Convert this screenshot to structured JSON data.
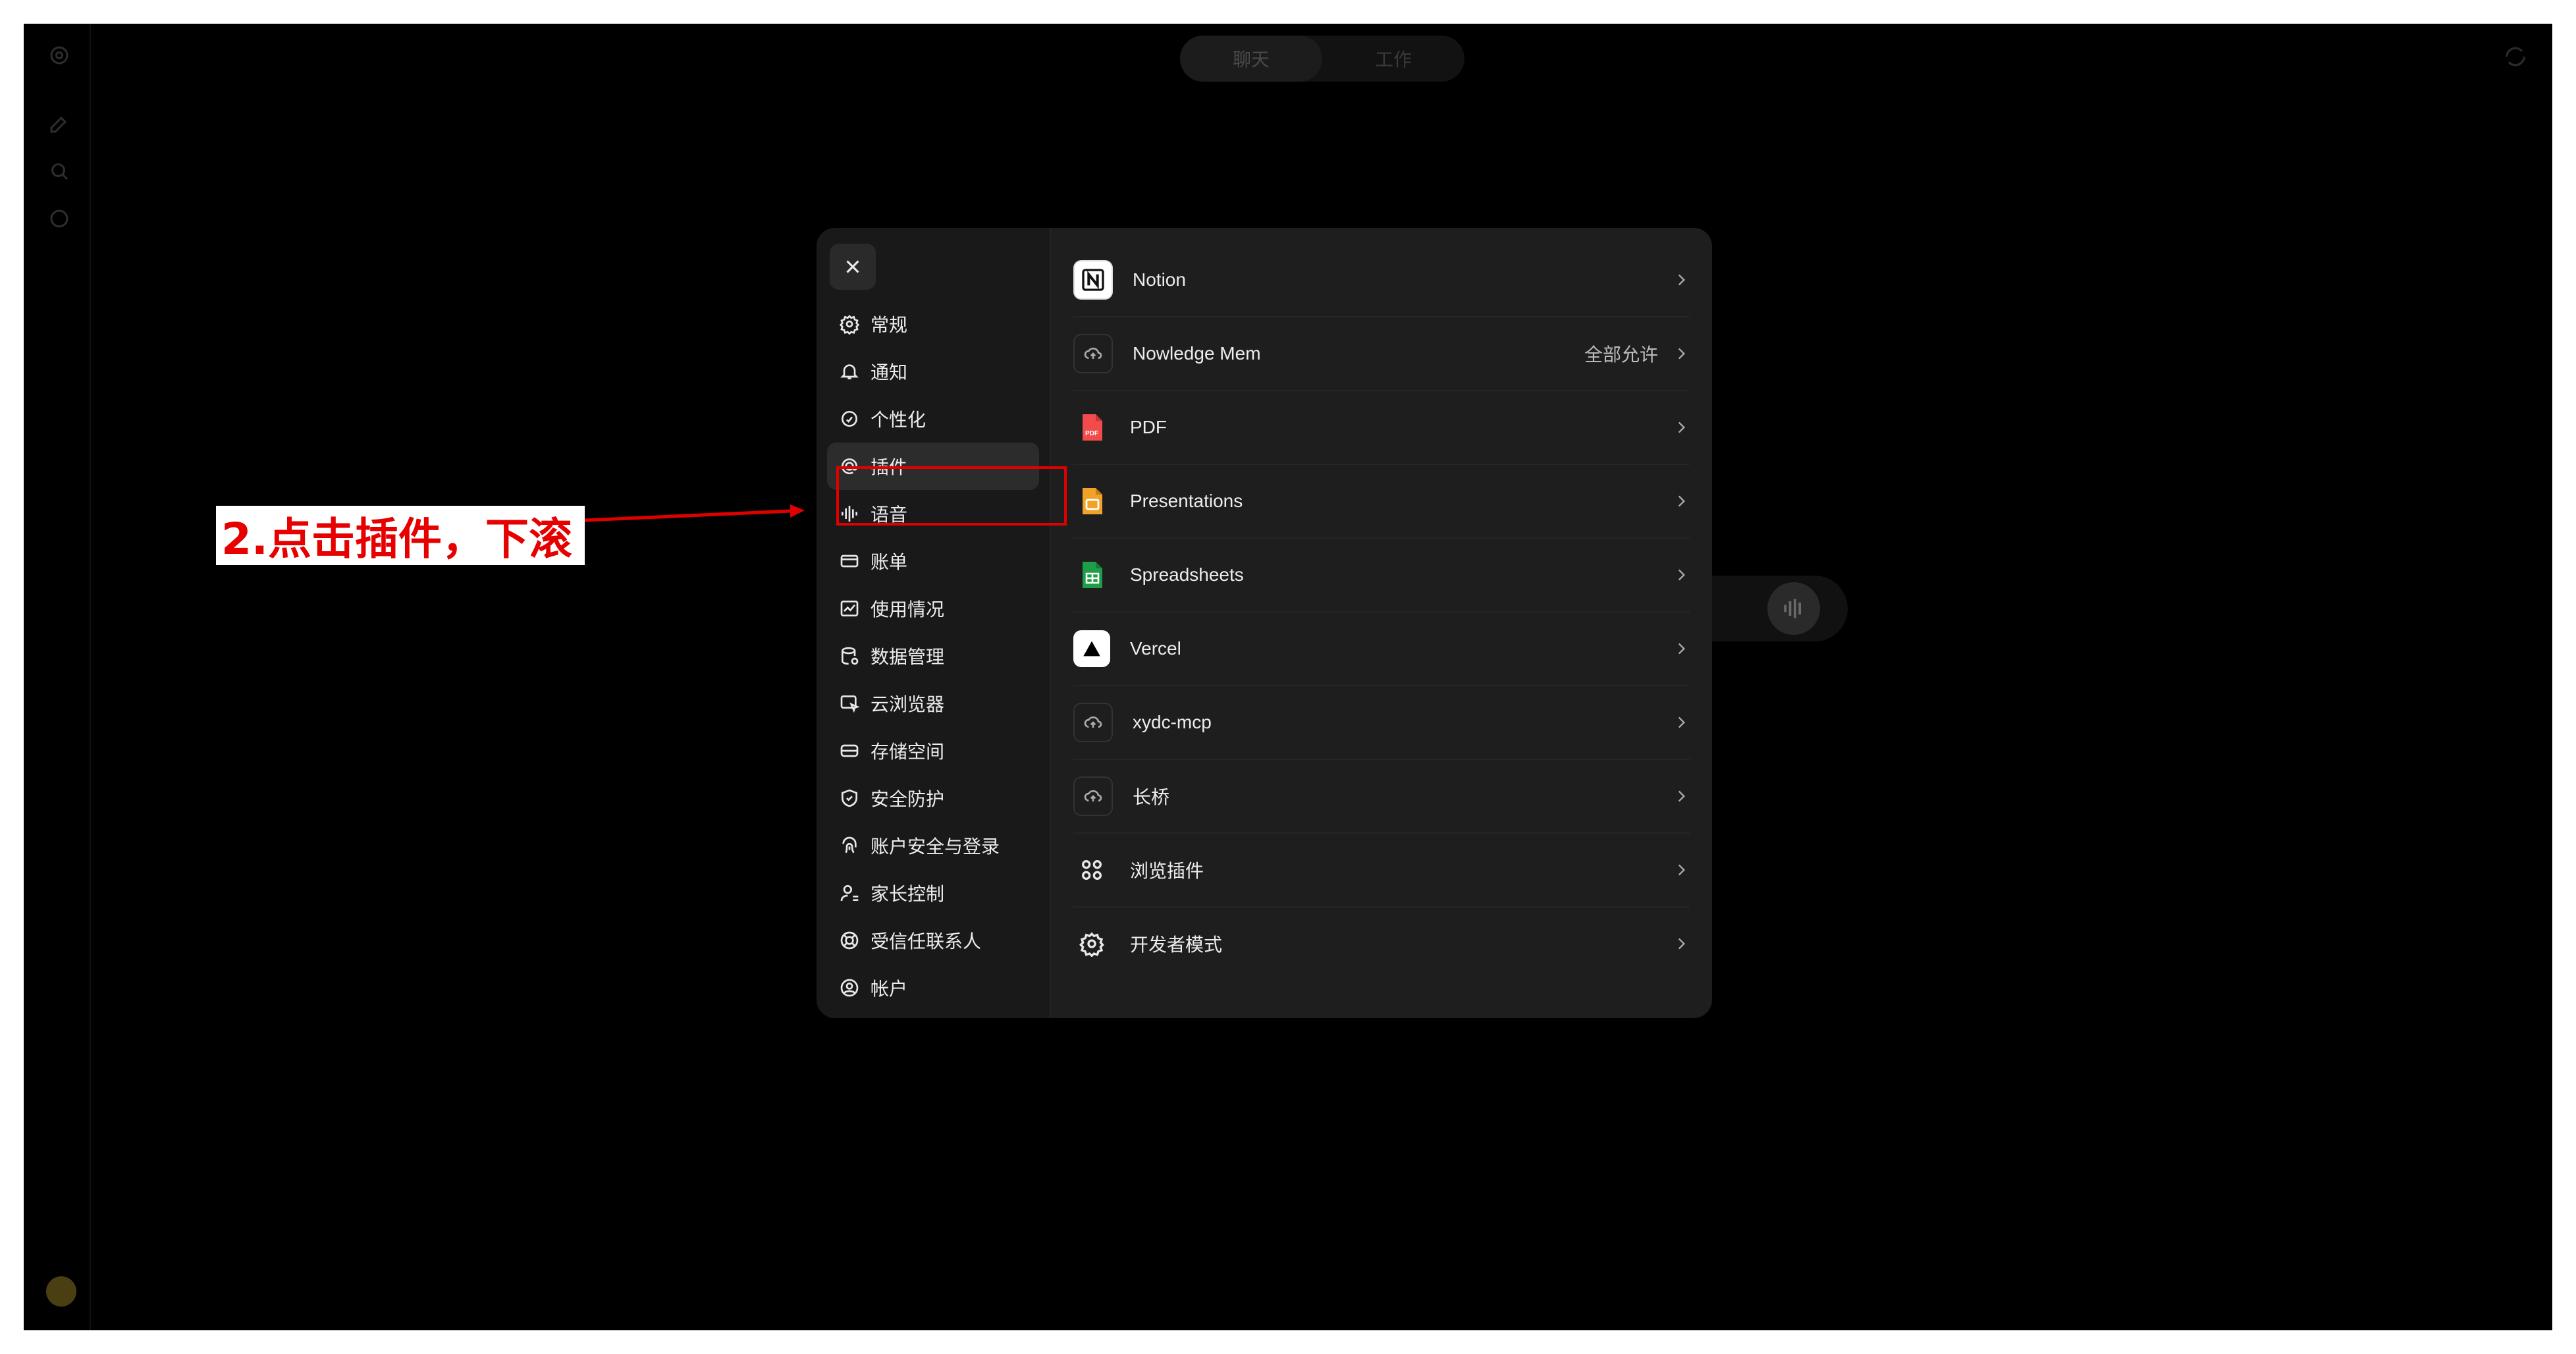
{
  "topbar": {
    "tab_chat": "聊天",
    "tab_work": "工作"
  },
  "settings_nav": {
    "items": [
      {
        "label": "常规"
      },
      {
        "label": "通知"
      },
      {
        "label": "个性化"
      },
      {
        "label": "插件"
      },
      {
        "label": "语音"
      },
      {
        "label": "账单"
      },
      {
        "label": "使用情况"
      },
      {
        "label": "数据管理"
      },
      {
        "label": "云浏览器"
      },
      {
        "label": "存储空间"
      },
      {
        "label": "安全防护"
      },
      {
        "label": "账户安全与登录"
      },
      {
        "label": "家长控制"
      },
      {
        "label": "受信任联系人"
      },
      {
        "label": "帐户"
      }
    ],
    "active_index": 3
  },
  "plugins": {
    "items": [
      {
        "label": "Notion",
        "right": "",
        "icon": "notion-icon"
      },
      {
        "label": "Nowledge Mem",
        "right": "全部允许",
        "icon": "cloud-upload-icon"
      },
      {
        "label": "PDF",
        "right": "",
        "icon": "pdf-icon"
      },
      {
        "label": "Presentations",
        "right": "",
        "icon": "presentations-icon"
      },
      {
        "label": "Spreadsheets",
        "right": "",
        "icon": "spreadsheets-icon"
      },
      {
        "label": "Vercel",
        "right": "",
        "icon": "vercel-icon"
      },
      {
        "label": "xydc-mcp",
        "right": "",
        "icon": "cloud-upload-icon"
      },
      {
        "label": "长桥",
        "right": "",
        "icon": "cloud-upload-icon"
      },
      {
        "label": "浏览插件",
        "right": "",
        "icon": "grid-icon"
      },
      {
        "label": "开发者模式",
        "right": "",
        "icon": "gear-icon"
      }
    ]
  },
  "annotation": {
    "text": "2.点击插件，下滚"
  },
  "colors": {
    "accent_red": "#e10000",
    "modal_bg": "#1e1e1e",
    "app_bg": "#000000"
  }
}
